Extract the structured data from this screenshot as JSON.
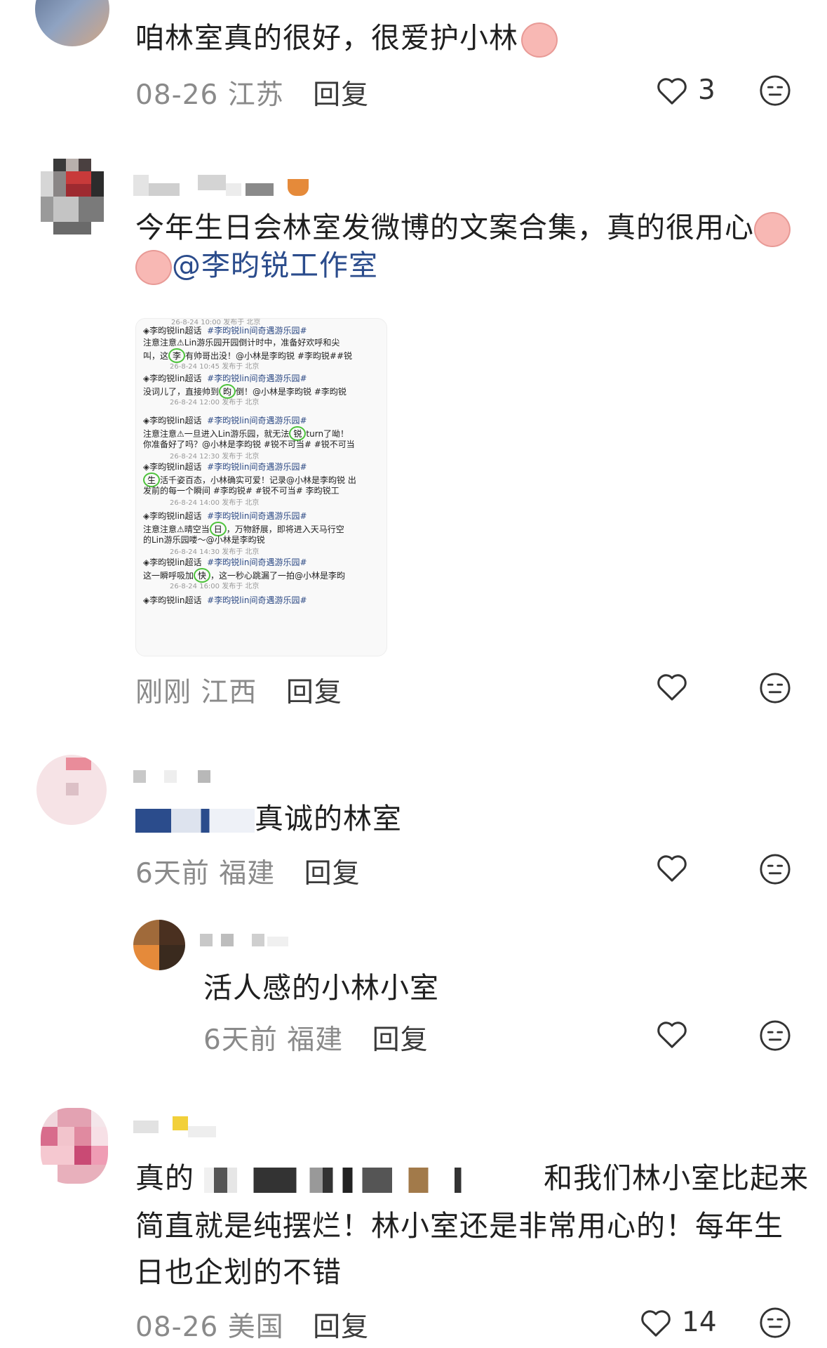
{
  "comments": [
    {
      "text": "咱林室真的很好，很爱护小林",
      "date": "08-26",
      "location": "江苏",
      "reply_label": "回复",
      "likes": "3"
    },
    {
      "text_line1": "今年生日会林室发微博的文案合集，真的很用心",
      "mention": "@李昀锐工作室",
      "date": "刚刚",
      "location": "江西",
      "reply_label": "回复",
      "likes": "",
      "image": {
        "top_meta": "26-8-24 10:00 发布于 北京",
        "posts": [
          {
            "source": "李昀锐lin超话",
            "topic": "#李昀锐lin间奇遇游乐园#",
            "pre": "注意注意⚠Lin游乐园开园倒计时中，准备好欢呼和尖",
            "l2pre": "叫，这",
            "circle": "李",
            "l2post": "有帅哥出没！@小林是李昀锐 #李昀锐##锐",
            "meta": "26-8-24 10:45 发布于 北京"
          },
          {
            "source": "李昀锐lin超话",
            "topic": "#李昀锐lin间奇遇游乐园#",
            "pre": "",
            "l2pre": "没词儿了，直接帅到",
            "circle": "昀",
            "l2post": "倒！@小林是李昀锐 #李昀锐",
            "meta": "26-8-24 12:00 发布于 北京"
          },
          {
            "source": "李昀锐lin超话",
            "topic": "#李昀锐lin间奇遇游乐园#",
            "pre": "",
            "l2pre": "注意注意⚠一旦进入Lin游乐园，就无法",
            "circle": "锐",
            "l2post": "turn了呦！",
            "l3": "你准备好了吗？@小林是李昀锐 #锐不可当# #锐不可当",
            "meta": "26-8-24 12:30 发布于 北京"
          },
          {
            "source": "李昀锐lin超话",
            "topic": "#李昀锐lin间奇遇游乐园#",
            "pre": "",
            "l2pre": "",
            "circle": "生",
            "l2post": "活千姿百态，小林确实可爱！记录@小林是李昀锐 出",
            "l3": "发前的每一个瞬间 #李昀锐# #锐不可当# 李昀锐工",
            "meta": "26-8-24 14:00 发布于 北京"
          },
          {
            "source": "李昀锐lin超话",
            "topic": "#李昀锐lin间奇遇游乐园#",
            "pre": "",
            "l2pre": "注意注意⚠晴空当",
            "circle": "日",
            "l2post": "，万物舒展，即将进入天马行空",
            "l3": "的Lin游乐园喽～@小林是李昀锐",
            "meta": "26-8-24 14:30 发布于 北京"
          },
          {
            "source": "李昀锐lin超话",
            "topic": "#李昀锐lin间奇遇游乐园#",
            "pre": "",
            "l2pre": "这一瞬呼吸加",
            "circle": "快",
            "l2post": "，这一秒心跳漏了一拍@小林是李昀",
            "meta": "26-8-24 16:00 发布于 北京"
          },
          {
            "source": "李昀锐lin超话",
            "topic": "#李昀锐lin间奇遇游乐园#",
            "pre": "",
            "l2pre": "",
            "circle": "",
            "l2post": "",
            "meta": ""
          }
        ]
      }
    },
    {
      "text": "真诚的林室",
      "date": "6天前",
      "location": "福建",
      "reply_label": "回复",
      "likes": ""
    },
    {
      "text": "活人感的小林小室",
      "date": "6天前",
      "location": "福建",
      "reply_label": "回复",
      "likes": ""
    },
    {
      "text_line1_end": "和我们林小室比起来",
      "text_line1_start": "真的",
      "text_line2": "简直就是纯摆烂！林小室还是非常用心的！每年生",
      "text_line3": "日也企划的不错",
      "date": "08-26",
      "location": "美国",
      "reply_label": "回复",
      "likes": "14"
    }
  ],
  "colors": {
    "meta": "#8a8a8a",
    "circle": "#4cc23a",
    "hashtag": "#2d4a85"
  },
  "icons": [
    "heart-outline-icon",
    "meh-face-icon",
    "piglet-emoji-icon"
  ]
}
